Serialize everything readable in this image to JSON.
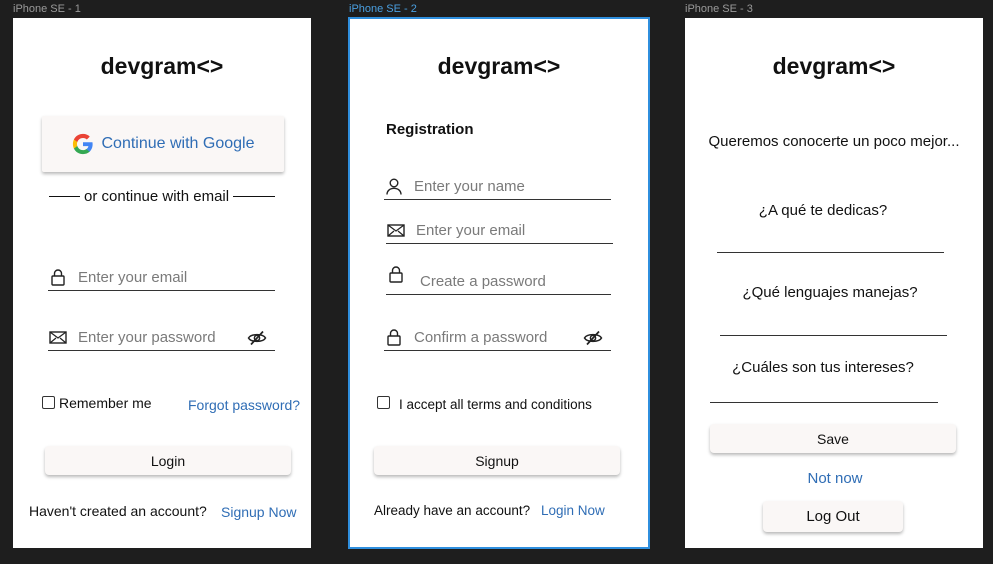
{
  "frames": [
    {
      "label": "iPhone SE - 1"
    },
    {
      "label": "iPhone SE - 2"
    },
    {
      "label": "iPhone SE - 3"
    }
  ],
  "brand": "devgram<>",
  "login": {
    "google_label": "Continue with Google",
    "divider_text": "or continue with email",
    "email_placeholder": "Enter your email",
    "password_placeholder": "Enter your password",
    "remember_label": "Remember me",
    "forgot_label": "Forgot password?",
    "login_label": "Login",
    "no_account_text": "Haven't created an account?",
    "signup_link": "Signup Now"
  },
  "registration": {
    "heading": "Registration",
    "name_placeholder": "Enter your name",
    "email_placeholder": "Enter your email",
    "password_placeholder": "Create a password",
    "confirm_placeholder": "Confirm a password",
    "terms_label": "I accept all terms and conditions",
    "signup_label": "Signup",
    "have_account_text": "Already have an account?",
    "login_link": "Login Now"
  },
  "profile": {
    "intro": "Queremos conocerte un poco mejor...",
    "q1": "¿A qué te dedicas?",
    "q2": "¿Qué lenguajes manejas?",
    "q3": "¿Cuáles son tus intereses?",
    "save_label": "Save",
    "not_now_label": "Not now",
    "logout_label": "Log Out"
  },
  "colors": {
    "link": "#2f6db5",
    "selection": "#2f8fde",
    "canvas": "#1e1e1e"
  }
}
